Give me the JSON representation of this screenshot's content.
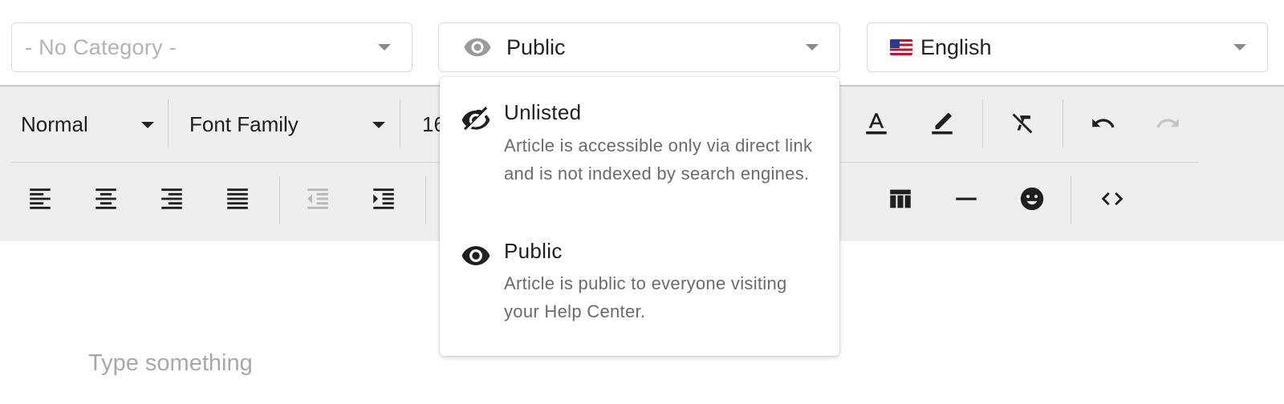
{
  "filters": {
    "category": {
      "value": "- No Category -"
    },
    "visibility": {
      "value": "Public",
      "icon": "eye-icon"
    },
    "language": {
      "value": "English",
      "flag": "us-flag-icon"
    }
  },
  "toolbar": {
    "block_format": "Normal",
    "font_family": "Font Family",
    "font_size": "16"
  },
  "editor": {
    "placeholder": "Type something"
  },
  "visibility_menu": {
    "options": [
      {
        "title": "Unlisted",
        "description": "Article is accessible only via direct link and is not indexed by search engines.",
        "icon": "eye-off-icon"
      },
      {
        "title": "Public",
        "description": "Article is public to everyone visiting your Help Center.",
        "icon": "eye-icon"
      }
    ]
  }
}
